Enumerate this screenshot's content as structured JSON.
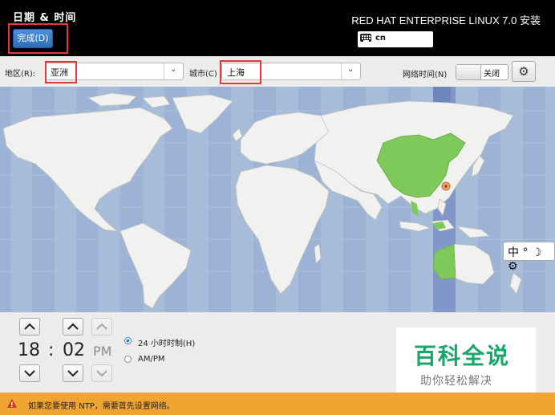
{
  "header": {
    "title": "日期 & 时间",
    "done_label": "完成(D)",
    "product": "RED HAT ENTERPRISE LINUX 7.0 安装",
    "keyboard_layout": "cn"
  },
  "toolbar": {
    "region_label": "地区(R):",
    "region_value": "亚洲",
    "city_label": "城市(C)",
    "city_value": "上海",
    "ntp_label": "网络时间(N)",
    "ntp_state": "关闭"
  },
  "time": {
    "hours": "18",
    "separator": ":",
    "minutes": "02",
    "ampm": "PM",
    "format_24h_label": "24 小时时制(H)",
    "format_ampm_label": "AM/PM",
    "selected_format": "24h"
  },
  "map": {
    "selected_timezone": "Asia/Shanghai",
    "highlight_color": "#7fc95a",
    "band_color": "#8ea4d0"
  },
  "warning": {
    "text": "如果您要使用 NTP，需要首先设置网络。"
  },
  "ime": {
    "label": "中 ° ☽ ⚙"
  },
  "watermark": {
    "title": "百科全说",
    "subtitle": "助你轻松解决"
  }
}
